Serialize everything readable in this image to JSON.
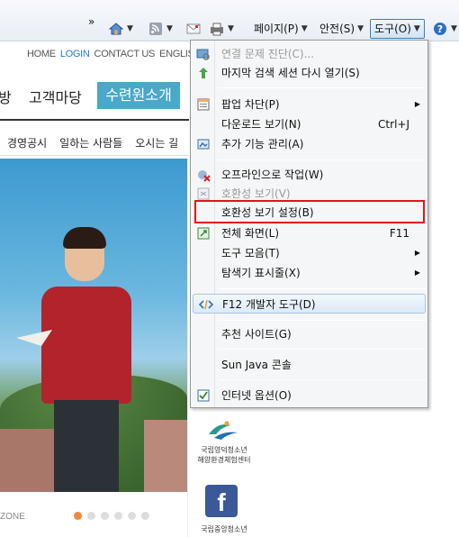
{
  "commandbar": {
    "chevron": "»",
    "page": "페이지(P)",
    "safety": "안전(S)",
    "tools": "도구(O)",
    "help_icon": "help-icon"
  },
  "site": {
    "toplinks": [
      "HOME",
      "LOGIN",
      "CONTACT US",
      "ENGLISH"
    ],
    "mainnav": [
      "방",
      "고객마당",
      "수련원소개"
    ],
    "subnav": [
      "경영공시",
      "일하는 사람들",
      "오시는 길"
    ],
    "zone_label": "ZONE",
    "side_label1_line1": "국립영덕청소년",
    "side_label1_line2": "해양환경체험센터",
    "side_label2": "국립중앙청소년",
    "fb": "f"
  },
  "menu": {
    "items": [
      {
        "label": "연결 문제 진단(C)...",
        "disabled": true,
        "icon": "diagnose-icon"
      },
      {
        "label": "마지막 검색 세션 다시 열기(S)",
        "icon": "reopen-icon"
      },
      {
        "label": "팝업 차단(P)",
        "submenu": true,
        "icon": "popup-icon"
      },
      {
        "label": "다운로드 보기(N)",
        "shortcut": "Ctrl+J"
      },
      {
        "label": "추가 기능 관리(A)",
        "icon": "addons-icon"
      },
      {
        "label": "오프라인으로 작업(W)",
        "icon": "offline-icon"
      },
      {
        "label": "호환성 보기(V)",
        "disabled": true,
        "icon": "compat-icon"
      },
      {
        "label": "호환성 보기 설정(B)"
      },
      {
        "label": "전체 화면(L)",
        "shortcut": "F11",
        "icon": "fullscreen-icon"
      },
      {
        "label": "도구 모음(T)",
        "submenu": true
      },
      {
        "label": "탐색기 표시줄(X)",
        "submenu": true
      },
      {
        "label": "F12 개발자 도구(D)",
        "icon": "devtools-icon"
      },
      {
        "label": "추천 사이트(G)"
      },
      {
        "label": "Sun Java 콘솔"
      },
      {
        "label": "인터넷 옵션(O)",
        "icon": "options-icon"
      }
    ]
  }
}
